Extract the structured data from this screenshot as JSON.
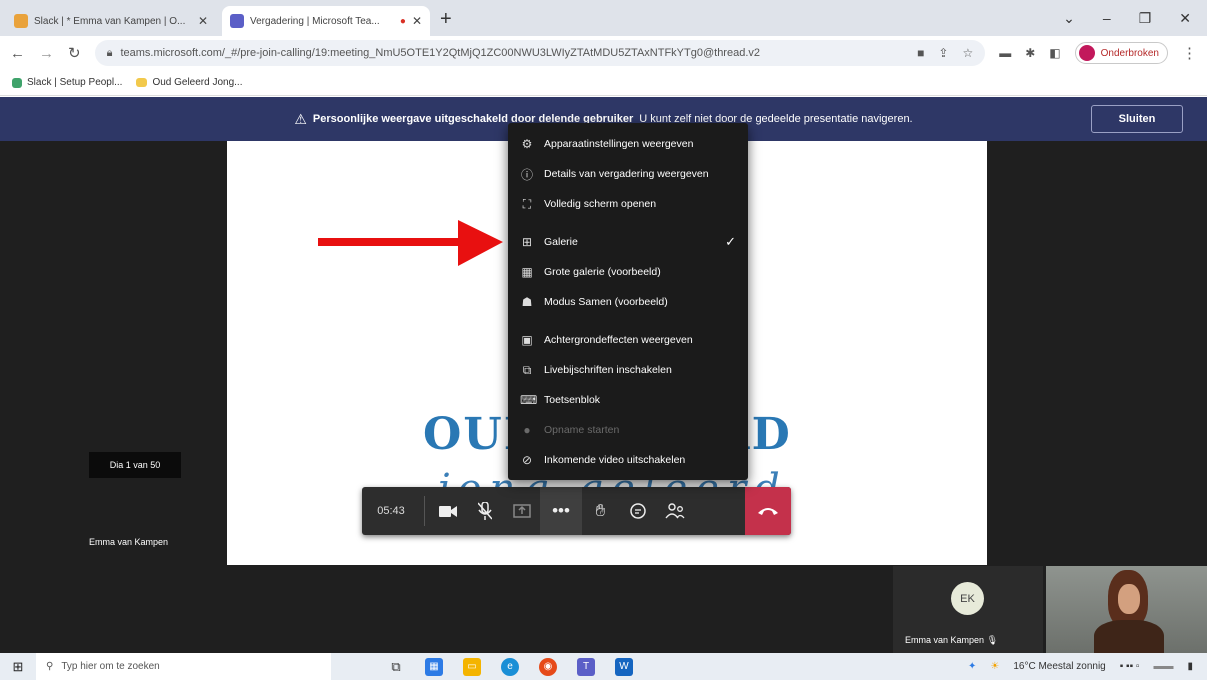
{
  "browser": {
    "tabs": [
      {
        "title": "Slack | * Emma van Kampen | O...",
        "active": false,
        "favicon_color": "#e9a23b"
      },
      {
        "title": "Vergadering | Microsoft Tea...",
        "active": true,
        "favicon_color": "#5b5fc7"
      }
    ],
    "new_tab": "+",
    "url": "teams.microsoft.com/_#/pre-join-calling/19:meeting_NmU5OTE1Y2QtMjQ1ZC00NWU3LWIyZTAtMDU5ZTAxNTFkYTg0@thread.v2",
    "profile_label": "Onderbroken",
    "bookmarks": [
      {
        "label": "Slack | Setup Peopl..."
      },
      {
        "label": "Oud Geleerd Jong..."
      }
    ],
    "window_controls": {
      "chevron": "⌄",
      "minimize": "–",
      "restore": "❐",
      "close": "✕"
    }
  },
  "banner": {
    "bold_text": "Persoonlijke weergave uitgeschakeld door delende gebruiker",
    "text": "U kunt zelf niet door de gedeelde presentatie navigeren.",
    "close_label": "Sluiten"
  },
  "presentation": {
    "logo_left": "OUI",
    "logo_right": "RD",
    "script_text": "jong geleerd",
    "page_indicator": "Dia 1 van 50",
    "presenter_name": "Emma van Kampen"
  },
  "controls": {
    "timer": "05:43"
  },
  "menu": {
    "items": [
      {
        "label": "Apparaatinstellingen weergeven",
        "icon": "⚙",
        "icon_name": "settings-icon",
        "checked": false,
        "disabled": false
      },
      {
        "label": "Details van vergadering weergeven",
        "icon": "ⓘ",
        "icon_name": "info-icon",
        "checked": false,
        "disabled": false
      },
      {
        "label": "Volledig scherm openen",
        "icon": "⛶",
        "icon_name": "fullscreen-icon",
        "checked": false,
        "disabled": false,
        "sep_after": true
      },
      {
        "label": "Galerie",
        "icon": "⊞",
        "icon_name": "gallery-icon",
        "checked": true,
        "disabled": false
      },
      {
        "label": "Grote galerie (voorbeeld)",
        "icon": "▦",
        "icon_name": "large-gallery-icon",
        "checked": false,
        "disabled": false
      },
      {
        "label": "Modus Samen (voorbeeld)",
        "icon": "☗",
        "icon_name": "together-mode-icon",
        "checked": false,
        "disabled": false,
        "sep_after": true
      },
      {
        "label": "Achtergrondeffecten weergeven",
        "icon": "▣",
        "icon_name": "background-effects-icon",
        "checked": false,
        "disabled": false
      },
      {
        "label": "Livebijschriften inschakelen",
        "icon": "⧉",
        "icon_name": "captions-icon",
        "checked": false,
        "disabled": false
      },
      {
        "label": "Toetsenblok",
        "icon": "⌨",
        "icon_name": "keypad-icon",
        "checked": false,
        "disabled": false
      },
      {
        "label": "Opname starten",
        "icon": "●",
        "icon_name": "record-icon",
        "checked": false,
        "disabled": true
      },
      {
        "label": "Inkomende video uitschakelen",
        "icon": "⊘",
        "icon_name": "video-off-icon",
        "checked": false,
        "disabled": false
      }
    ],
    "check_glyph": "✓"
  },
  "participants": {
    "me_initials": "EK",
    "me_name": "Emma van Kampen"
  },
  "taskbar": {
    "search_placeholder": "Typ hier om te zoeken",
    "weather": "16°C  Meestal zonnig"
  },
  "colors": {
    "teams_banner": "#2e3766",
    "hangup": "#c4314b",
    "annotation_arrow": "#e81010"
  }
}
